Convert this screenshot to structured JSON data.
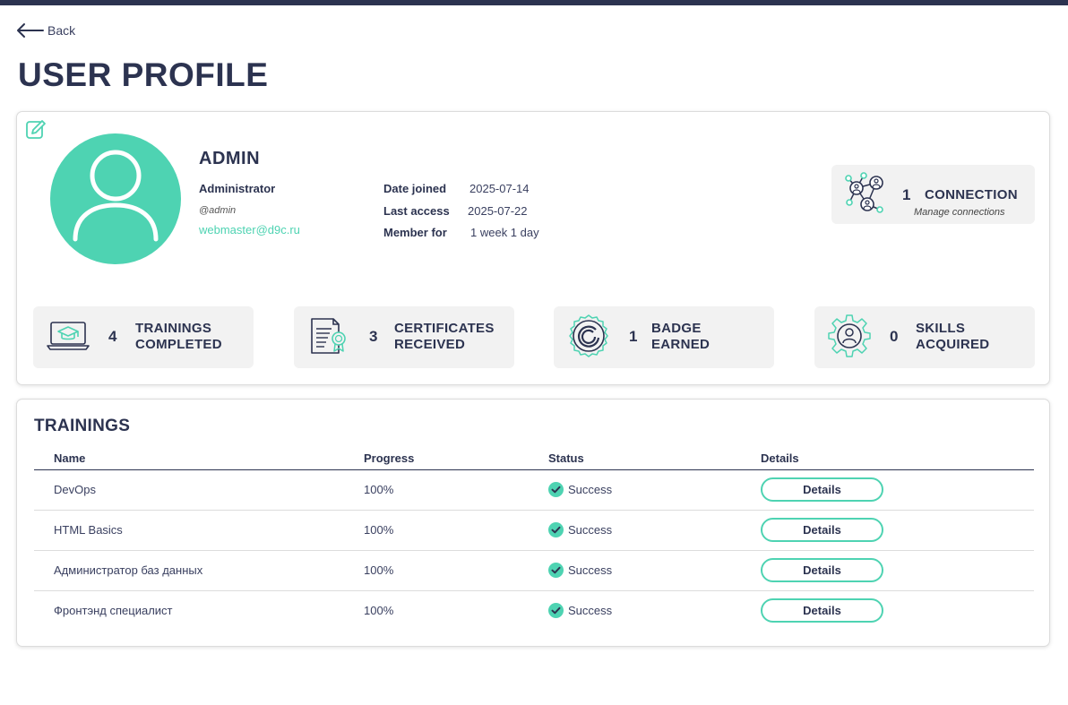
{
  "nav": {
    "back_label": "Back"
  },
  "page": {
    "title": "USER PROFILE"
  },
  "profile": {
    "name": "ADMIN",
    "role": "Administrator",
    "handle": "@admin",
    "email": "webmaster@d9c.ru",
    "meta": [
      {
        "label": "Date joined",
        "value": "2025-07-14"
      },
      {
        "label": "Last access",
        "value": "2025-07-22"
      },
      {
        "label": "Member for",
        "value": "1 week 1 day"
      }
    ],
    "connections": {
      "count": "1",
      "label": "CONNECTION",
      "sublabel": "Manage connections"
    }
  },
  "stats": [
    {
      "icon": "laptop-graduation-icon",
      "count": "4",
      "line1": "TRAININGS",
      "line2": "COMPLETED"
    },
    {
      "icon": "certificate-icon",
      "count": "3",
      "line1": "CERTIFICATES",
      "line2": "RECEIVED"
    },
    {
      "icon": "badge-icon",
      "count": "1",
      "line1": "BADGE",
      "line2": "EARNED"
    },
    {
      "icon": "gear-user-icon",
      "count": "0",
      "line1": "SKILLS",
      "line2": "ACQUIRED"
    }
  ],
  "trainings": {
    "title": "TRAININGS",
    "columns": [
      "Name",
      "Progress",
      "Status",
      "Details"
    ],
    "rows": [
      {
        "name": "DevOps",
        "progress": "100%",
        "status": "Success",
        "details": "Details"
      },
      {
        "name": "HTML Basics",
        "progress": "100%",
        "status": "Success",
        "details": "Details"
      },
      {
        "name": "Администратор баз данных",
        "progress": "100%",
        "status": "Success",
        "details": "Details"
      },
      {
        "name": "Фронтэнд специалист",
        "progress": "100%",
        "status": "Success",
        "details": "Details"
      }
    ]
  },
  "colors": {
    "accent": "#4ed3b2",
    "navy": "#2c3350",
    "tile_bg": "#f2f2f2"
  }
}
